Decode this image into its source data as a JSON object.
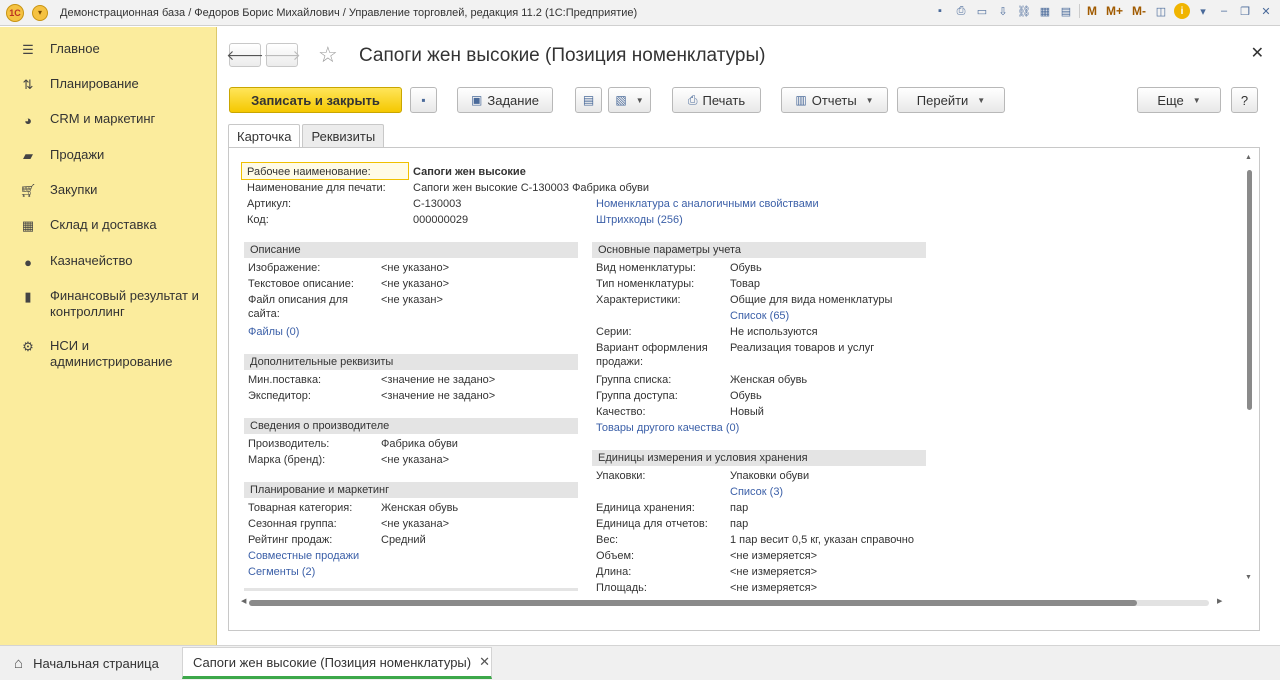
{
  "titlebar": {
    "title": "Демонстрационная база / Федоров Борис Михайлович / Управление торговлей, редакция 11.2  (1С:Предприятие)",
    "m_labels": [
      "M",
      "M+",
      "M-"
    ]
  },
  "sidebar": {
    "items": [
      {
        "label": "Главное",
        "icon": "menu-icon"
      },
      {
        "label": "Планирование",
        "icon": "planning-icon"
      },
      {
        "label": "CRM и маркетинг",
        "icon": "pie-chart-icon"
      },
      {
        "label": "Продажи",
        "icon": "sales-icon"
      },
      {
        "label": "Закупки",
        "icon": "cart-icon"
      },
      {
        "label": "Склад и доставка",
        "icon": "warehouse-icon"
      },
      {
        "label": "Казначейство",
        "icon": "coin-icon"
      },
      {
        "label": "Финансовый результат и контроллинг",
        "icon": "bar-chart-icon"
      },
      {
        "label": "НСИ и администрирование",
        "icon": "gear-icon"
      }
    ]
  },
  "form": {
    "title": "Сапоги жен высокие (Позиция номенклатуры)",
    "buttons": {
      "save_close": "Записать и закрыть",
      "task": "Задание",
      "print": "Печать",
      "reports": "Отчеты",
      "goto": "Перейти",
      "more": "Еще",
      "help": "?"
    },
    "tabs": [
      "Карточка",
      "Реквизиты"
    ]
  },
  "card": {
    "top": [
      {
        "label": "Рабочее наименование:",
        "value": "Сапоги жен высокие"
      },
      {
        "label": "Наименование для печати:",
        "value": "Сапоги жен высокие С-130003 Фабрика обуви"
      },
      {
        "label": "Артикул:",
        "value": "С-130003"
      },
      {
        "label": "Код:",
        "value": "000000029"
      }
    ],
    "top_links": [
      "Номенклатура с аналогичными свойствами",
      "Штрихкоды (256)"
    ],
    "left_sections": [
      {
        "title": "Описание",
        "rows": [
          {
            "label": "Изображение:",
            "value": "<не указано>"
          },
          {
            "label": "Текстовое описание:",
            "value": "<не указано>"
          },
          {
            "label": "Файл описания для",
            "label2": "сайта:",
            "value": "<не указан>"
          }
        ],
        "link": "Файлы (0)"
      },
      {
        "title": "Дополнительные реквизиты",
        "rows": [
          {
            "label": "Мин.поставка:",
            "value": "<значение не задано>"
          },
          {
            "label": "Экспедитор:",
            "value": "<значение не задано>"
          }
        ]
      },
      {
        "title": "Сведения о производителе",
        "rows": [
          {
            "label": "Производитель:",
            "value": "Фабрика обуви"
          },
          {
            "label": "Марка (бренд):",
            "value": "<не указана>"
          }
        ]
      },
      {
        "title": "Планирование и маркетинг",
        "rows": [
          {
            "label": "Товарная категория:",
            "value": "Женская обувь"
          },
          {
            "label": "Сезонная группа:",
            "value": "<не указана>"
          },
          {
            "label": "Рейтинг продаж:",
            "value": "Средний"
          }
        ],
        "links": [
          "Совместные продажи",
          "Сегменты (2)"
        ]
      }
    ],
    "right_sections": [
      {
        "title": "Основные параметры учета",
        "rows": [
          {
            "label": "Вид номенклатуры:",
            "value": "Обувь"
          },
          {
            "label": "Тип номенклатуры:",
            "value": "Товар"
          },
          {
            "label": "Характеристики:",
            "value": "Общие для вида номенклатуры",
            "link": "Список (65)"
          },
          {
            "label": "Серии:",
            "value": "Не используются"
          },
          {
            "label": "Вариант оформления",
            "label2": "продажи:",
            "value": "Реализация товаров и услуг"
          },
          {
            "label": "Группа списка:",
            "value": "Женская обувь"
          },
          {
            "label": "Группа доступа:",
            "value": "Обувь"
          },
          {
            "label": "Качество:",
            "value": "Новый"
          }
        ],
        "link": "Товары другого качества (0)"
      },
      {
        "title": "Единицы измерения и условия хранения",
        "rows": [
          {
            "label": "Упаковки:",
            "value": "Упаковки обуви",
            "link": "Список (3)"
          },
          {
            "label": "Единица хранения:",
            "value": "пар"
          },
          {
            "label": "Единица для отчетов:",
            "value": "пар"
          },
          {
            "label": "Вес:",
            "value": "1 пар весит 0,5 кг, указан справочно"
          },
          {
            "label": "Объем:",
            "value": "<не измеряется>"
          },
          {
            "label": "Длина:",
            "value": "<не измеряется>"
          },
          {
            "label": "Площадь:",
            "value": "<не измеряется>"
          }
        ]
      }
    ]
  },
  "bottom": {
    "home_tab": "Начальная страница",
    "doc_tab": "Сапоги жен высокие (Позиция номенклатуры)"
  },
  "colors": {
    "sidebar_bg": "#fbec9d",
    "primary_button": "#f5c800",
    "link": "#3c60a8",
    "active_tab_underline": "#3da84a"
  }
}
